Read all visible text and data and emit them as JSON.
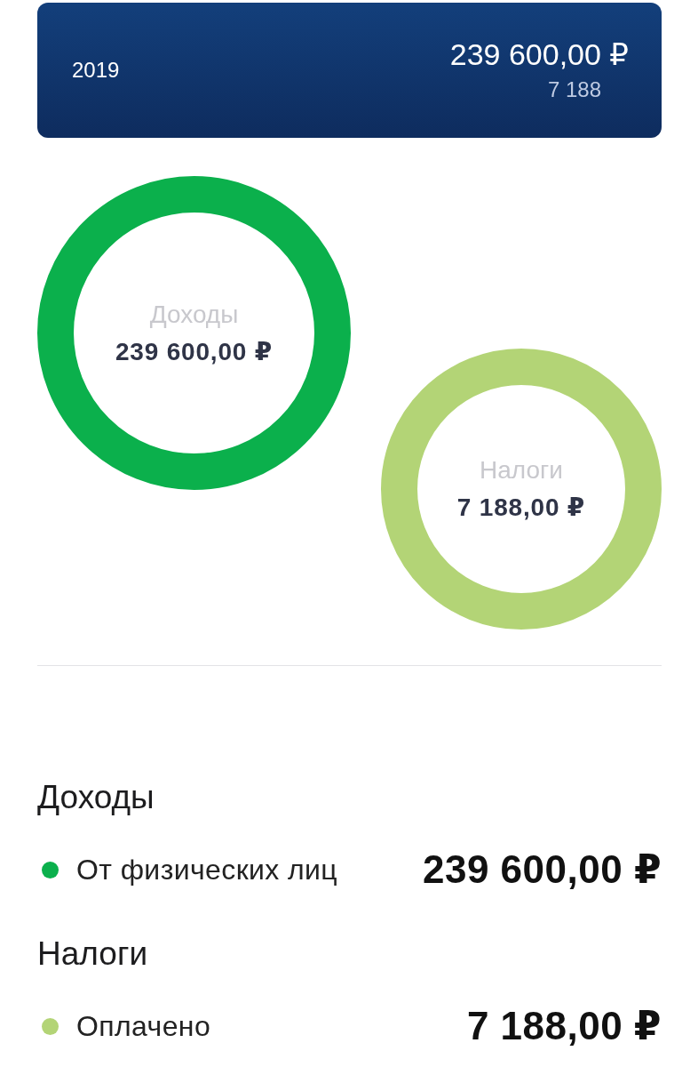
{
  "summary_card": {
    "year": "2019",
    "income_total": "239 600,00 ₽",
    "tax_total": "7 188"
  },
  "rings": [
    {
      "label": "Доходы",
      "amount": "239 600,00 ₽",
      "color": "#0bb04c"
    },
    {
      "label": "Налоги",
      "amount": "7 188,00 ₽",
      "color": "#b3d476"
    }
  ],
  "sections": [
    {
      "title": "Доходы",
      "items": [
        {
          "label": "От физических лиц",
          "amount": "239 600,00 ₽",
          "color": "#0bb04c"
        }
      ]
    },
    {
      "title": "Налоги",
      "items": [
        {
          "label": "Оплачено",
          "amount": "7 188,00 ₽",
          "color": "#b3d476"
        }
      ]
    }
  ]
}
